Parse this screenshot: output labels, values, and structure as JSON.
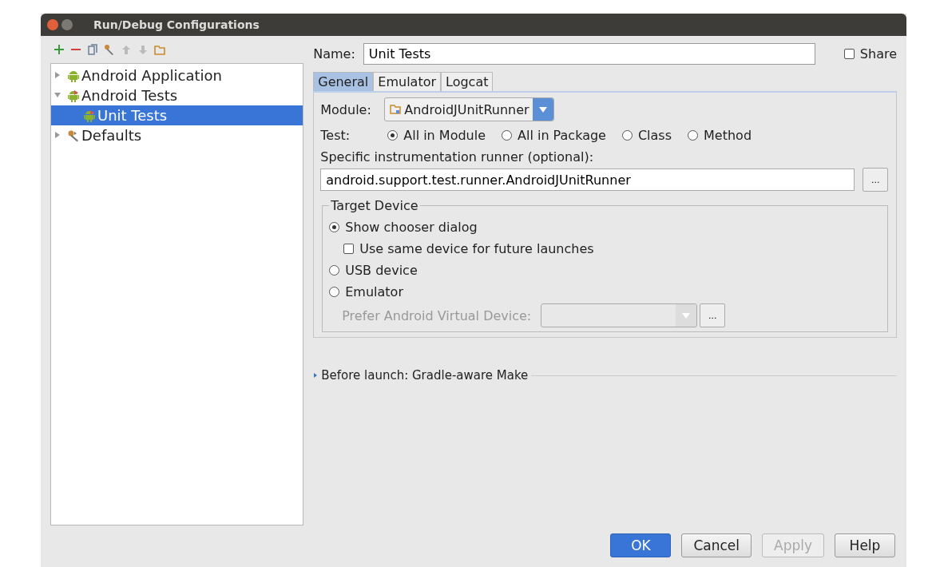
{
  "window": {
    "title": "Run/Debug Configurations"
  },
  "tree": [
    {
      "label": "Android Application",
      "kind": "android",
      "expanded": false,
      "selected": false
    },
    {
      "label": "Android Tests",
      "kind": "android-test",
      "expanded": true,
      "selected": false,
      "children": [
        {
          "label": "Unit Tests",
          "kind": "android-test",
          "selected": true
        }
      ]
    },
    {
      "label": "Defaults",
      "kind": "defaults",
      "expanded": false,
      "selected": false
    }
  ],
  "name": {
    "label": "Name:",
    "value": "Unit Tests"
  },
  "share": {
    "label": "Share",
    "checked": false
  },
  "tabs": [
    {
      "label": "General",
      "selected": true
    },
    {
      "label": "Emulator",
      "selected": false
    },
    {
      "label": "Logcat",
      "selected": false
    }
  ],
  "module": {
    "label": "Module:",
    "value": "AndroidJUnitRunner"
  },
  "test": {
    "label": "Test:",
    "options": [
      {
        "label": "All in Module",
        "selected": true
      },
      {
        "label": "All in Package",
        "selected": false
      },
      {
        "label": "Class",
        "selected": false
      },
      {
        "label": "Method",
        "selected": false
      }
    ]
  },
  "runner": {
    "label": "Specific instrumentation runner (optional):",
    "value": "android.support.test.runner.AndroidJUnitRunner",
    "button": "..."
  },
  "target_device": {
    "title": "Target Device",
    "options": [
      {
        "kind": "radio",
        "label": "Show chooser dialog",
        "selected": true
      },
      {
        "kind": "checkbox",
        "label": "Use same device for future launches",
        "checked": false
      },
      {
        "kind": "radio",
        "label": "USB device",
        "selected": false
      },
      {
        "kind": "radio",
        "label": "Emulator",
        "selected": false
      }
    ],
    "prefer": {
      "label": "Prefer Android Virtual Device:",
      "disabled": true,
      "button": "..."
    }
  },
  "before_launch": {
    "label": "Before launch: Gradle-aware Make",
    "expanded": false
  },
  "buttons": [
    {
      "label": "OK",
      "kind": "primary",
      "disabled": false
    },
    {
      "label": "Cancel",
      "kind": "normal",
      "disabled": false
    },
    {
      "label": "Apply",
      "kind": "normal",
      "disabled": true
    },
    {
      "label": "Help",
      "kind": "normal",
      "disabled": false
    }
  ]
}
